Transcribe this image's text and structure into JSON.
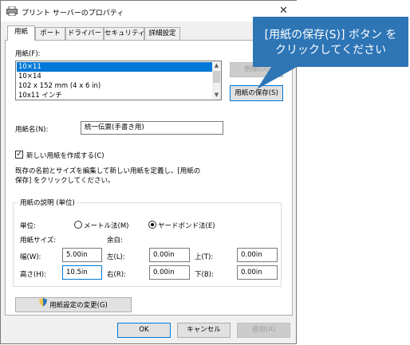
{
  "window": {
    "title": "プリント サーバーのプロパティ"
  },
  "tabs": [
    {
      "label": "用紙",
      "active": true
    },
    {
      "label": "ポート",
      "active": false
    },
    {
      "label": "ドライバー",
      "active": false
    },
    {
      "label": "セキュリティ",
      "active": false
    },
    {
      "label": "詳細設定",
      "active": false
    }
  ],
  "forms_label": "用紙(F):",
  "forms_list": [
    {
      "label": "10×11",
      "selected": true
    },
    {
      "label": "10×14",
      "selected": false
    },
    {
      "label": "102 x 152 mm (4 x 6 in)",
      "selected": false
    },
    {
      "label": "10x11 インチ",
      "selected": false
    }
  ],
  "buttons": {
    "delete": "削除(D)",
    "save_form": "用紙の保存(S)",
    "change_settings": "用紙設定の変更(G)",
    "ok": "OK",
    "cancel": "キャンセル",
    "apply": "適用(A)"
  },
  "form_name": {
    "label": "用紙名(N):",
    "value": "統一伝票(手書き用)"
  },
  "create_new": {
    "label": "新しい用紙を作成する(C)",
    "checked": true
  },
  "description": "既存の名前とサイズを編集して新しい用紙を定義し、[用紙の保存] をクリックしてください。",
  "form_desc": {
    "group_title": "用紙の説明 (単位)",
    "units_label": "単位:",
    "metric_label": "メートル法(M)",
    "english_label": "ヤードポンド法(E)",
    "selected_unit": "english",
    "paper_size_label": "用紙サイズ:",
    "margins_label": "余白:",
    "width": {
      "label": "幅(W):",
      "value": "5.00in"
    },
    "height": {
      "label": "高さ(H):",
      "value": "10.5in"
    },
    "left": {
      "label": "左(L):",
      "value": "0.00in"
    },
    "right": {
      "label": "右(R):",
      "value": "0.00in"
    },
    "top": {
      "label": "上(T):",
      "value": "0.00in"
    },
    "bottom": {
      "label": "下(B):",
      "value": "0.00in"
    }
  },
  "callout": {
    "line1": "[用紙の保存(S)] ボタン を",
    "line2": "クリックしてください",
    "color": "#2e75b6"
  },
  "colors": {
    "accent": "#0078d7",
    "dialog_bg": "#f0f0f0"
  }
}
